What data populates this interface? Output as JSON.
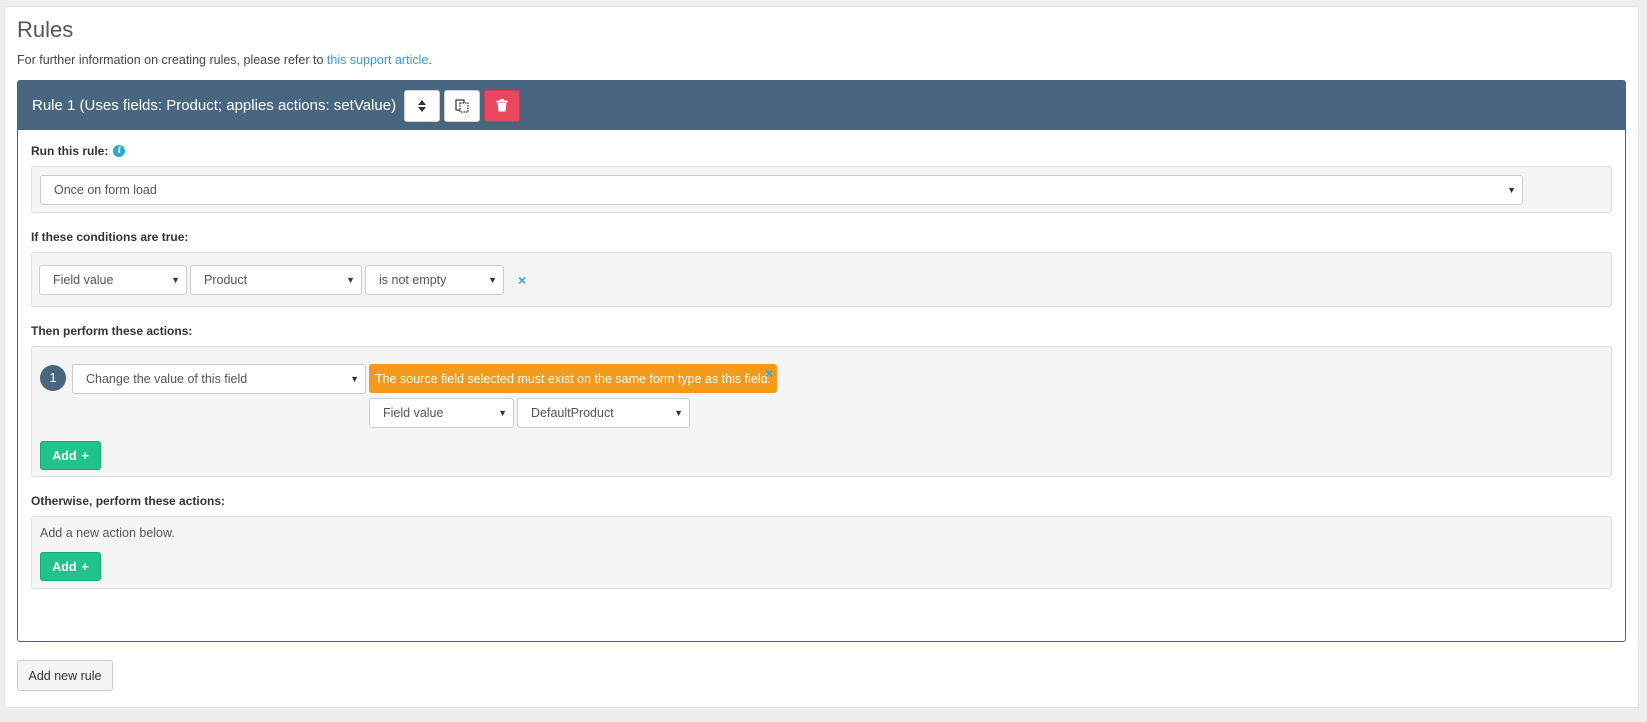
{
  "page": {
    "title": "Rules",
    "intro_text": "For further information on creating rules, please refer to",
    "intro_link": "this support article",
    "intro_end": "."
  },
  "rule": {
    "header_title": "Rule 1 (Uses fields: Product; applies actions: setValue)",
    "run_label": "Run this rule:",
    "run_value": "Once on form load",
    "conditions_label": "If these conditions are true:",
    "condition": {
      "type": "Field value",
      "field": "Product",
      "operator": "is not empty",
      "remove": "×"
    },
    "actions_label": "Then perform these actions:",
    "action": {
      "number": "1",
      "action_type": "Change the value of this field",
      "warning": "The source field selected must exist on the same form type as this field.",
      "source_type": "Field value",
      "source_field": "DefaultProduct",
      "remove": "×"
    },
    "add_label": "Add",
    "otherwise_label": "Otherwise, perform these actions:",
    "otherwise_hint": "Add a new action below.",
    "otherwise_add_label": "Add"
  },
  "footer": {
    "add_rule_label": "Add new rule"
  },
  "colors": {
    "header_bg": "#496681",
    "danger": "#e8485d",
    "success": "#1fc38b",
    "warning": "#f49a1a",
    "link": "#3a9bc8"
  },
  "icons": {
    "sort": "sort-icon",
    "copy": "copy-icon",
    "delete": "trash-icon",
    "info": "info-icon",
    "caret": "caret-down-icon"
  }
}
